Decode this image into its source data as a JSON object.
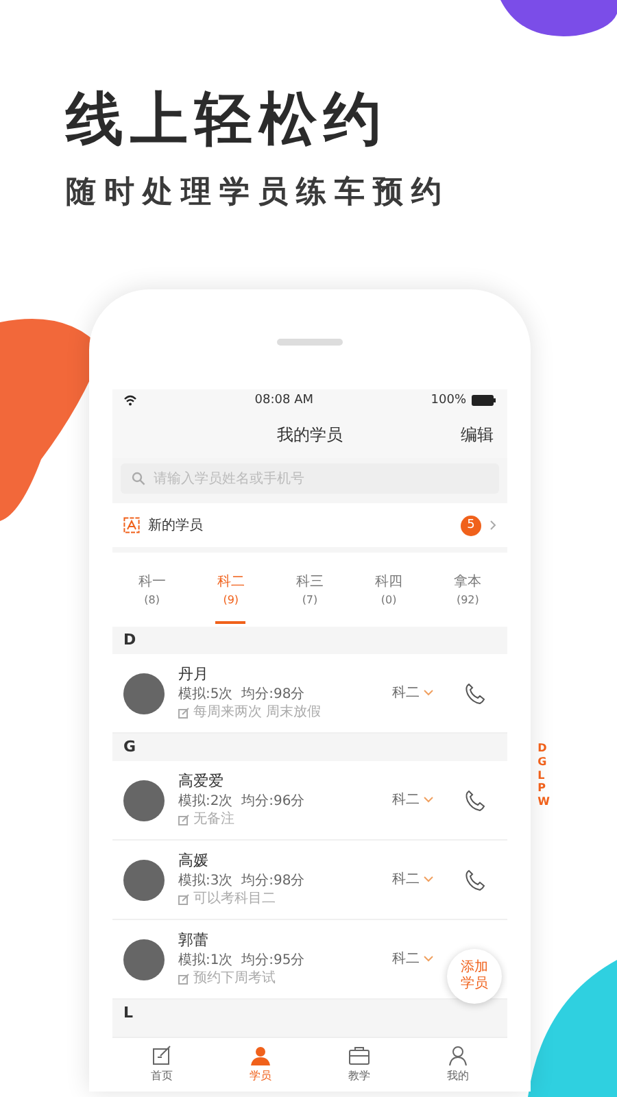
{
  "headline": "线上轻松约",
  "subheadline": "随时处理学员练车预约",
  "status_bar": {
    "time": "08:08 AM",
    "battery": "100%"
  },
  "nav": {
    "title": "我的学员",
    "action": "编辑"
  },
  "search": {
    "placeholder": "请输入学员姓名或手机号"
  },
  "new_students": {
    "label": "新的学员",
    "count": "5"
  },
  "tabs": [
    {
      "label": "科一",
      "count": "(8)",
      "selected": false
    },
    {
      "label": "科二",
      "count": "(9)",
      "selected": true
    },
    {
      "label": "科三",
      "count": "(7)",
      "selected": false
    },
    {
      "label": "科四",
      "count": "(0)",
      "selected": false
    },
    {
      "label": "拿本",
      "count": "(92)",
      "selected": false
    }
  ],
  "sections": [
    {
      "letter": "D",
      "students": [
        {
          "name": "丹月",
          "stats": "模拟:5次  均分:98分",
          "note": "每周来两次 周末放假",
          "subject": "科二"
        }
      ]
    },
    {
      "letter": "G",
      "students": [
        {
          "name": "高爱爱",
          "stats": "模拟:2次  均分:96分",
          "note": "无备注",
          "subject": "科二"
        },
        {
          "name": "高媛",
          "stats": "模拟:3次  均分:98分",
          "note": "可以考科目二",
          "subject": "科二"
        },
        {
          "name": "郭蕾",
          "stats": "模拟:1次  均分:95分",
          "note": "预约下周考试",
          "subject": "科二"
        }
      ]
    },
    {
      "letter": "L"
    }
  ],
  "index": [
    "D",
    "G",
    "L",
    "P",
    "W"
  ],
  "fab": "添加学员",
  "tab_bar": [
    {
      "label": "首页",
      "selected": false
    },
    {
      "label": "学员",
      "selected": true
    },
    {
      "label": "教学",
      "selected": false
    },
    {
      "label": "我的",
      "selected": false
    }
  ]
}
